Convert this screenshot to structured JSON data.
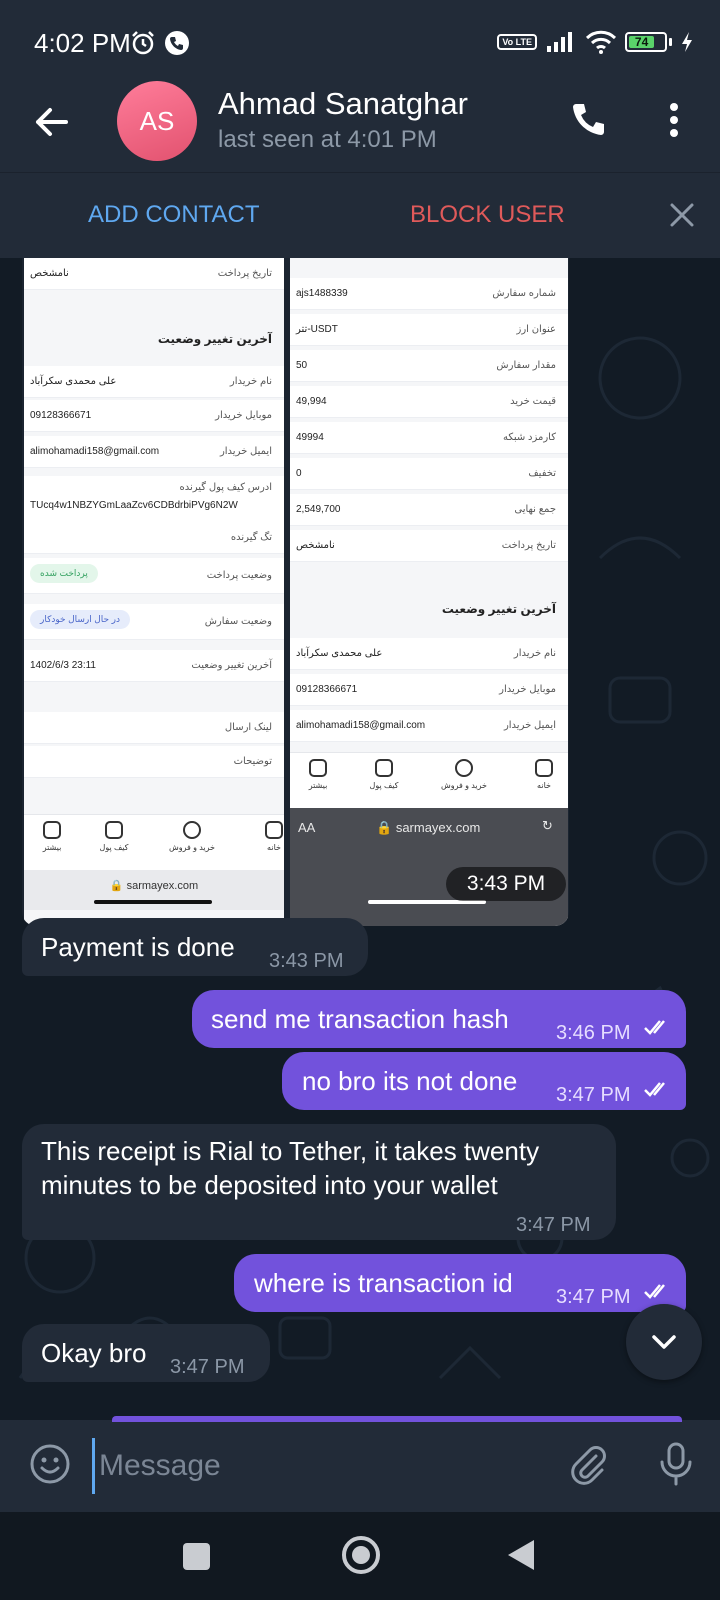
{
  "status_bar": {
    "time": "4:02 PM",
    "left_icons": [
      "alarm-icon",
      "phone-call-icon"
    ],
    "right_icons": [
      "volte-icon",
      "signal-icon",
      "wifi-icon",
      "battery-icon",
      "charging-icon"
    ],
    "volte": "Vo LTE",
    "battery": "74"
  },
  "header": {
    "avatar_initials": "AS",
    "avatar_color": "#e8607c",
    "name": "Ahmad Sanatghar",
    "last_seen": "last seen at 4:01 PM"
  },
  "action_bar": {
    "add_contact": "ADD CONTACT",
    "block_user": "BLOCK USER"
  },
  "image_message": {
    "time": "3:43 PM",
    "left_shot": {
      "rows": [
        {
          "key": "تاریخ پرداخت",
          "value": "نامشخص"
        },
        {
          "key": "نام خریدار",
          "value": "علی محمدی سکرآباد"
        },
        {
          "key": "موبایل خریدار",
          "value": "09128366671"
        },
        {
          "key": "ایمیل خریدار",
          "value": "alimohamadi158@gmail.com"
        },
        {
          "key": "ادرس کیف پول گیرنده",
          "value": "TUcq4w1NBZYGmLaaZcv6CDBdrbiPVg6N2W"
        },
        {
          "key": "تگ گیرنده",
          "value": ""
        },
        {
          "key": "وضعیت پرداخت",
          "value": "پرداخت شده"
        },
        {
          "key": "وضعیت سفارش",
          "value": "در حال ارسال خودکار"
        },
        {
          "key": "آخرین تغییر وضعیت",
          "value": "1402/6/3 23:11"
        },
        {
          "key": "لینک ارسال",
          "value": ""
        },
        {
          "key": "توضیحات",
          "value": ""
        }
      ],
      "section_title": "آخرین تغییر وضعیت",
      "tabs": [
        "بیشتر",
        "کیف پول",
        "خرید و فروش",
        "خانه"
      ],
      "url": "sarmayex.com"
    },
    "right_shot": {
      "rows": [
        {
          "key": "شماره سفارش",
          "value": "ajs1488339"
        },
        {
          "key": "عنوان ارز",
          "value": "تتر-USDT"
        },
        {
          "key": "مقدار سفارش",
          "value": "50"
        },
        {
          "key": "قیمت خرید",
          "value": "49,994"
        },
        {
          "key": "کارمزد شبکه",
          "value": "49994"
        },
        {
          "key": "تخفیف",
          "value": "0"
        },
        {
          "key": "جمع نهایی",
          "value": "2,549,700"
        },
        {
          "key": "تاریخ پرداخت",
          "value": "نامشخص"
        },
        {
          "key": "نام خریدار",
          "value": "علی محمدی سکرآباد"
        },
        {
          "key": "موبایل خریدار",
          "value": "09128366671"
        },
        {
          "key": "ایمیل خریدار",
          "value": "alimohamadi158@gmail.com"
        }
      ],
      "section_title": "آخرین تغییر وضعیت",
      "tabs": [
        "بیشتر",
        "کیف پول",
        "خرید و فروش",
        "خانه"
      ],
      "url_aa": "AA",
      "url": "sarmayex.com"
    }
  },
  "messages": [
    {
      "dir": "in",
      "text": "Payment is done",
      "time": "3:43 PM"
    },
    {
      "dir": "out",
      "text": "send me transaction hash",
      "time": "3:46 PM"
    },
    {
      "dir": "out",
      "text": "no bro its not done",
      "time": "3:47 PM"
    },
    {
      "dir": "in",
      "text_line1": "This receipt is Rial to Tether, it takes twenty",
      "text_line2": "minutes to be deposited into your wallet",
      "time": "3:47 PM"
    },
    {
      "dir": "out",
      "text": "where is transaction id",
      "time": "3:47 PM"
    },
    {
      "dir": "in",
      "text": "Okay bro",
      "time": "3:47 PM"
    }
  ],
  "composer": {
    "placeholder": "Message"
  },
  "colors": {
    "outgoing_bubble": "#7252dc",
    "incoming_bubble": "#222b38",
    "accent_blue": "#5fa8f0",
    "block_red": "#e05a5a"
  }
}
